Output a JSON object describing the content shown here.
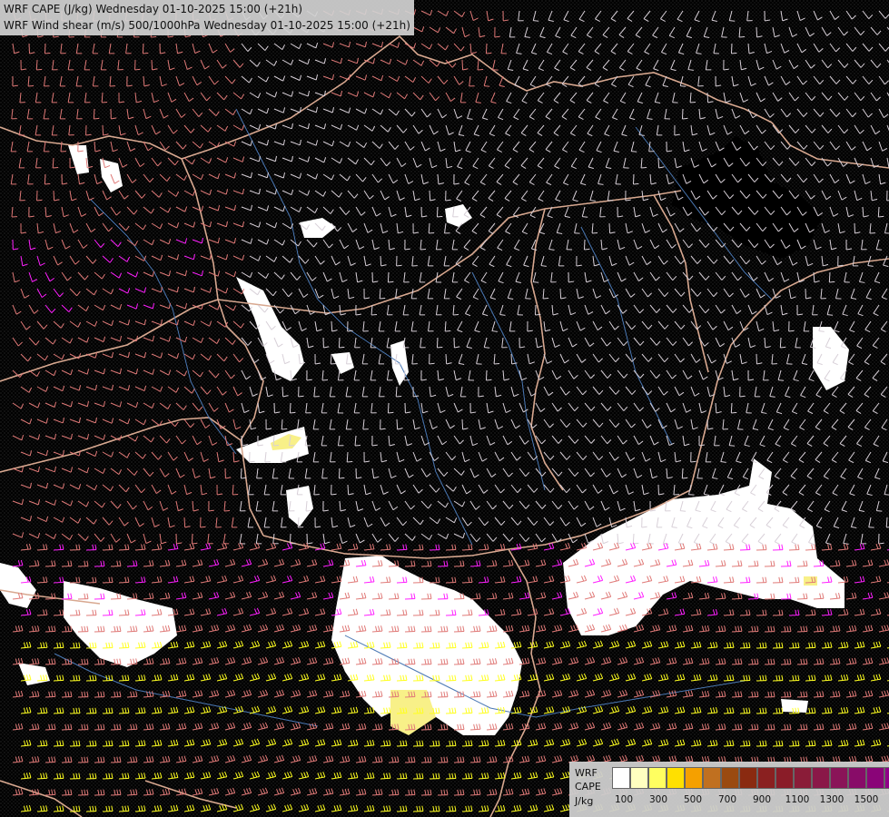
{
  "header": {
    "line1": "WRF CAPE (J/kg) Wednesday 01-10-2025 15:00 (+21h)",
    "line2": "WRF Wind shear (m/s) 500/1000hPa Wednesday 01-10-2025 15:00 (+21h)"
  },
  "legend": {
    "label_lines": [
      "WRF",
      "CAPE",
      "J/kg"
    ],
    "colors": [
      "#ffffff",
      "#ffffc0",
      "#ffff60",
      "#ffe000",
      "#f5a000",
      "#c07020",
      "#9a4a10",
      "#8a2a10",
      "#8a2020",
      "#8a1c28",
      "#8a1c38",
      "#8a1848",
      "#8a1458",
      "#880c68",
      "#8a0478",
      "#900088"
    ],
    "ticks": [
      "100",
      "300",
      "500",
      "700",
      "900",
      "1100",
      "1300",
      "1500"
    ]
  },
  "colors": {
    "background": "#000000",
    "borders": "#d8a890",
    "rivers": "#4a78b4",
    "barb_low": "#d8d0d8",
    "barb_mid": "#e07a78",
    "barb_high": "#ff20ff",
    "barb_strong": "#ffff20",
    "cape_low": "#ffffff",
    "cape_mid": "#f8f088"
  }
}
